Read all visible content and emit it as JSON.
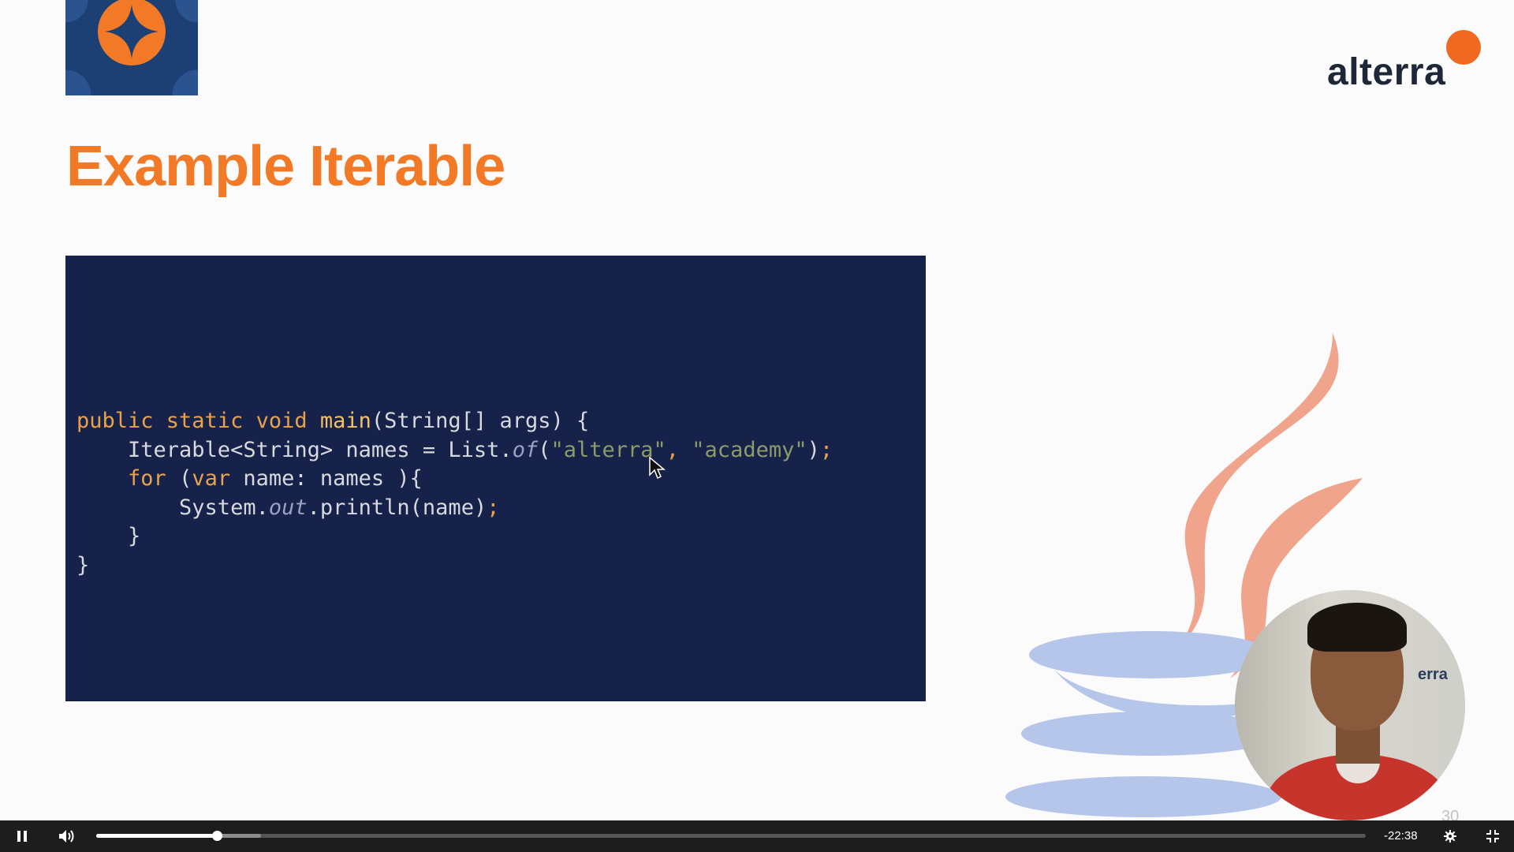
{
  "slide": {
    "brand": "alterra",
    "title": "Example Iterable",
    "code_lines": [
      "public static void main(String[] args) {",
      "    Iterable<String> names = List.of(\"alterra\", \"academy\");",
      "    for (var name: names ){",
      "        System.out.println(name);",
      "    }",
      "}"
    ],
    "webcam_sign": "erra",
    "page_number": "30"
  },
  "player": {
    "time_remaining": "-22:38",
    "progress_fraction": 0.095,
    "buffered_fraction": 0.13,
    "icons": {
      "play_pause": "pause-icon",
      "volume": "volume-icon",
      "settings": "gear-icon",
      "fullscreen": "exit-fullscreen-icon"
    }
  },
  "colors": {
    "title_orange": "#f27a27",
    "code_background": "#17224a",
    "brand_dot": "#f26a21",
    "control_bar": "#1d1d1d"
  }
}
